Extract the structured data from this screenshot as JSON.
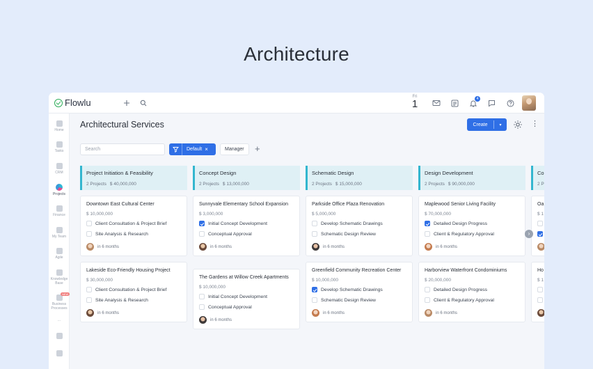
{
  "page_heading": "Architecture",
  "app": {
    "logo_text": "Flowlu",
    "date": {
      "dow": "Fri",
      "day": "1"
    },
    "notification_count": "4"
  },
  "sidebar": {
    "items": [
      {
        "label": "Home",
        "icon": "home-icon"
      },
      {
        "label": "Tasks",
        "icon": "tasks-icon"
      },
      {
        "label": "CRM",
        "icon": "crm-icon"
      },
      {
        "label": "Projects",
        "icon": "projects-icon",
        "active": true
      },
      {
        "label": "Finance",
        "icon": "finance-icon"
      },
      {
        "label": "My Team",
        "icon": "team-icon"
      },
      {
        "label": "Agile",
        "icon": "agile-icon"
      },
      {
        "label": "Knowledge Base",
        "icon": "knowledge-base-icon"
      },
      {
        "label": "Business Processes",
        "icon": "business-processes-icon",
        "badge": "NEW"
      }
    ],
    "more": "..."
  },
  "header": {
    "title": "Architectural Services",
    "create_label": "Create"
  },
  "filters": {
    "search_placeholder": "Search",
    "default_chip": "Default",
    "manager_chip": "Manager"
  },
  "columns": [
    {
      "title": "Project Initiation & Feasibility",
      "count": "2 Projects",
      "total": "$ 40,000,000",
      "cards": [
        {
          "title": "Downtown East Cultural Center",
          "price": "$ 10,000,000",
          "tasks": [
            {
              "label": "Client Consultation & Project Brief",
              "done": false
            },
            {
              "label": "Site Analysis & Research",
              "done": false
            }
          ],
          "due": "in 6 months"
        },
        {
          "title": "Lakeside Eco-Friendly Housing Project",
          "price": "$ 30,000,000",
          "tasks": [
            {
              "label": "Client Consultation & Project Brief",
              "done": false
            },
            {
              "label": "Site Analysis & Research",
              "done": false
            }
          ],
          "due": "in 6 months"
        }
      ]
    },
    {
      "title": "Concept Design",
      "count": "2 Projects",
      "total": "$ 13,000,000",
      "cards": [
        {
          "title": "Sunnyvale Elementary School Expansion",
          "price": "$ 3,000,000",
          "tasks": [
            {
              "label": "Initial Concept Development",
              "done": true
            },
            {
              "label": "Conceptual Approval",
              "done": false
            }
          ],
          "due": "in 6 months"
        },
        {
          "title": "The Gardens at Willow Creek Apartments",
          "price": "$ 10,000,000",
          "tasks": [
            {
              "label": "Initial Concept Development",
              "done": false
            },
            {
              "label": "Conceptual Approval",
              "done": false
            }
          ],
          "due": "in 6 months"
        }
      ]
    },
    {
      "title": "Schematic Design",
      "count": "2 Projects",
      "total": "$ 15,000,000",
      "cards": [
        {
          "title": "Parkside Office Plaza Renovation",
          "price": "$ 5,000,000",
          "tasks": [
            {
              "label": "Develop Schematic Drawings",
              "done": false
            },
            {
              "label": "Schematic Design Review",
              "done": false
            }
          ],
          "due": "in 6 months"
        },
        {
          "title": "Greenfield Community Recreation Center",
          "price": "$ 10,000,000",
          "tasks": [
            {
              "label": "Develop Schematic Drawings",
              "done": true
            },
            {
              "label": "Schematic Design Review",
              "done": false
            }
          ],
          "due": "in 6 months"
        }
      ]
    },
    {
      "title": "Design Development",
      "count": "2 Projects",
      "total": "$ 90,000,000",
      "cards": [
        {
          "title": "Maplewood Senior Living Facility",
          "price": "$ 70,000,000",
          "tasks": [
            {
              "label": "Detailed Design Progress",
              "done": true
            },
            {
              "label": "Client & Regulatory Approval",
              "done": false
            }
          ],
          "due": "in 6 months"
        },
        {
          "title": "Harborview Waterfront Condominiums",
          "price": "$ 20,000,000",
          "tasks": [
            {
              "label": "Detailed Design Progress",
              "done": false
            },
            {
              "label": "Client & Regulatory Approval",
              "done": false
            }
          ],
          "due": "in 6 months"
        }
      ]
    },
    {
      "title": "Co",
      "count": "2 P",
      "total": "",
      "cards": [
        {
          "title": "Oa",
          "price": "$ 1",
          "tasks": [
            {
              "label": "",
              "done": false
            },
            {
              "label": "",
              "done": true
            }
          ],
          "due": ""
        },
        {
          "title": "Ho",
          "price": "$ 1",
          "tasks": [
            {
              "label": "",
              "done": false
            },
            {
              "label": "",
              "done": false
            }
          ],
          "due": ""
        }
      ]
    }
  ],
  "colors": {
    "accent": "#2f6fe6",
    "column_header_bg": "#dff0f5",
    "column_header_border": "#33b6cf",
    "page_bg": "#e3ecfb"
  }
}
